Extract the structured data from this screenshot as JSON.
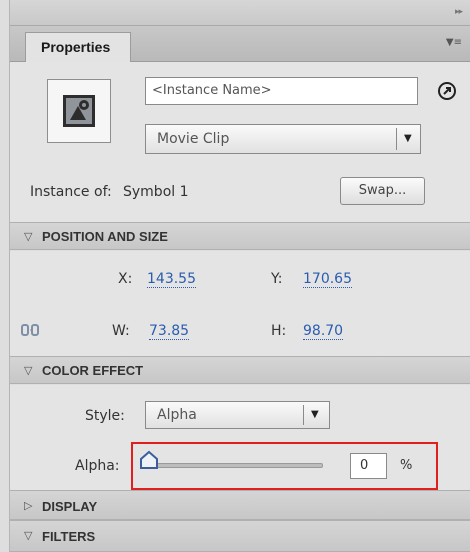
{
  "panel": {
    "tab_label": "Properties",
    "menu_icon": "panel-menu-icon",
    "collapse_icon": "collapse-arrows-icon"
  },
  "instance": {
    "symbol_icon": "movie-clip-symbol-icon",
    "name_placeholder": "<Instance Name>",
    "type_selected": "Movie Clip",
    "edit_icon": "target-path-icon",
    "instance_of_label": "Instance of:",
    "instance_of_value": "Symbol 1",
    "swap_label": "Swap..."
  },
  "position_and_size": {
    "header": "POSITION AND SIZE",
    "x_label": "X:",
    "x_value": "143.55",
    "y_label": "Y:",
    "y_value": "170.65",
    "lock_icon": "link-constrain-icon",
    "w_label": "W:",
    "w_value": "73.85",
    "h_label": "H:",
    "h_value": "98.70"
  },
  "color_effect": {
    "header": "COLOR EFFECT",
    "style_label": "Style:",
    "style_selected": "Alpha",
    "alpha_label": "Alpha:",
    "alpha_value": "0",
    "alpha_unit": "%"
  },
  "sections": {
    "display": "DISPLAY",
    "filters": "FILTERS"
  },
  "colors": {
    "hot_text": "#2a5db0",
    "highlight_box": "#e0201e"
  }
}
